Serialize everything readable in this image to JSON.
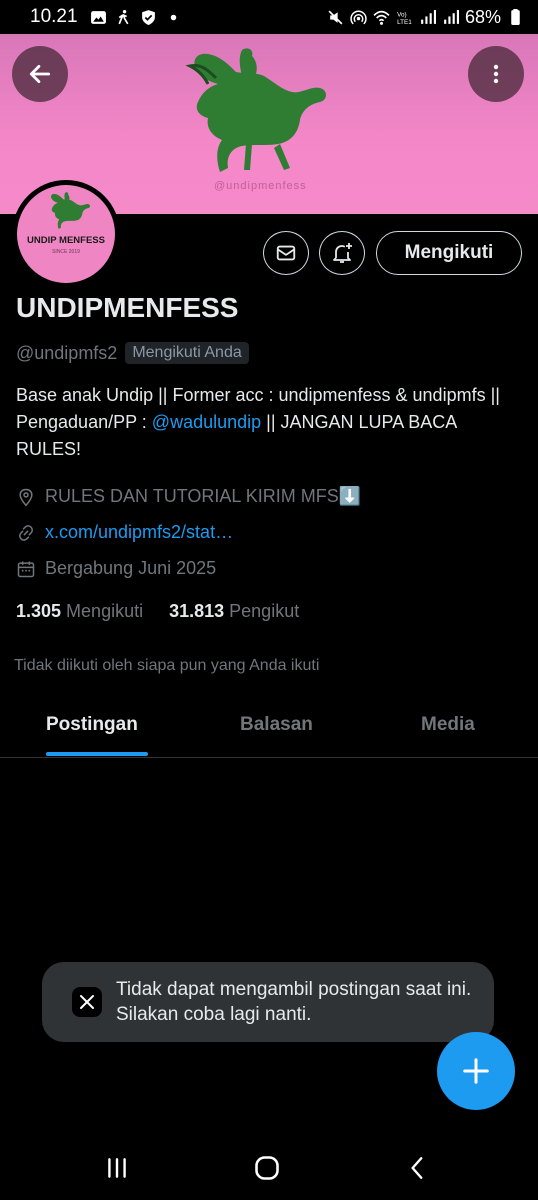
{
  "status_bar": {
    "time": "10.21",
    "battery": "68%",
    "lte": "Vo)\nLTE1"
  },
  "banner": {
    "watermark": "@undipmenfess",
    "background_color": "#f487c8",
    "horse_color": "#2e7d32"
  },
  "avatar": {
    "text": "UNDIP MENFESS",
    "subtext": "SINCE 2019"
  },
  "actions": {
    "follow_label": "Mengikuti"
  },
  "profile": {
    "name": "UNDIPMENFESS",
    "handle": "@undipmfs2",
    "follows_you": "Mengikuti Anda",
    "bio_part1": "Base anak Undip || Former acc : undipmenfess & undipmfs || Pengaduan/PP : ",
    "bio_mention": "@wadulundip",
    "bio_part2": " || JANGAN LUPA BACA RULES!",
    "location": "RULES DAN TUTORIAL KIRIM MFS⬇️",
    "link": "x.com/undipmfs2/stat…",
    "joined": "Bergabung Juni 2025",
    "following_count": "1.305",
    "following_label": "Mengikuti",
    "followers_count": "31.813",
    "followers_label": "Pengikut",
    "not_followed": "Tidak diikuti oleh siapa pun yang Anda ikuti"
  },
  "tabs": [
    {
      "label": "Postingan",
      "active": true
    },
    {
      "label": "Balasan",
      "active": false
    },
    {
      "label": "Media",
      "active": false
    }
  ],
  "toast": {
    "message": "Tidak dapat mengambil postingan saat ini. Silakan coba lagi nanti."
  },
  "icons": {
    "back": "arrow-left-icon",
    "more": "more-vertical-icon",
    "mail": "mail-icon",
    "bell": "bell-plus-icon",
    "location": "location-pin-icon",
    "link": "link-icon",
    "calendar": "calendar-icon",
    "compose": "plus-icon",
    "x_logo": "x-logo-icon"
  },
  "colors": {
    "accent": "#1d9bf0",
    "background": "#000000",
    "muted": "#71767b"
  }
}
